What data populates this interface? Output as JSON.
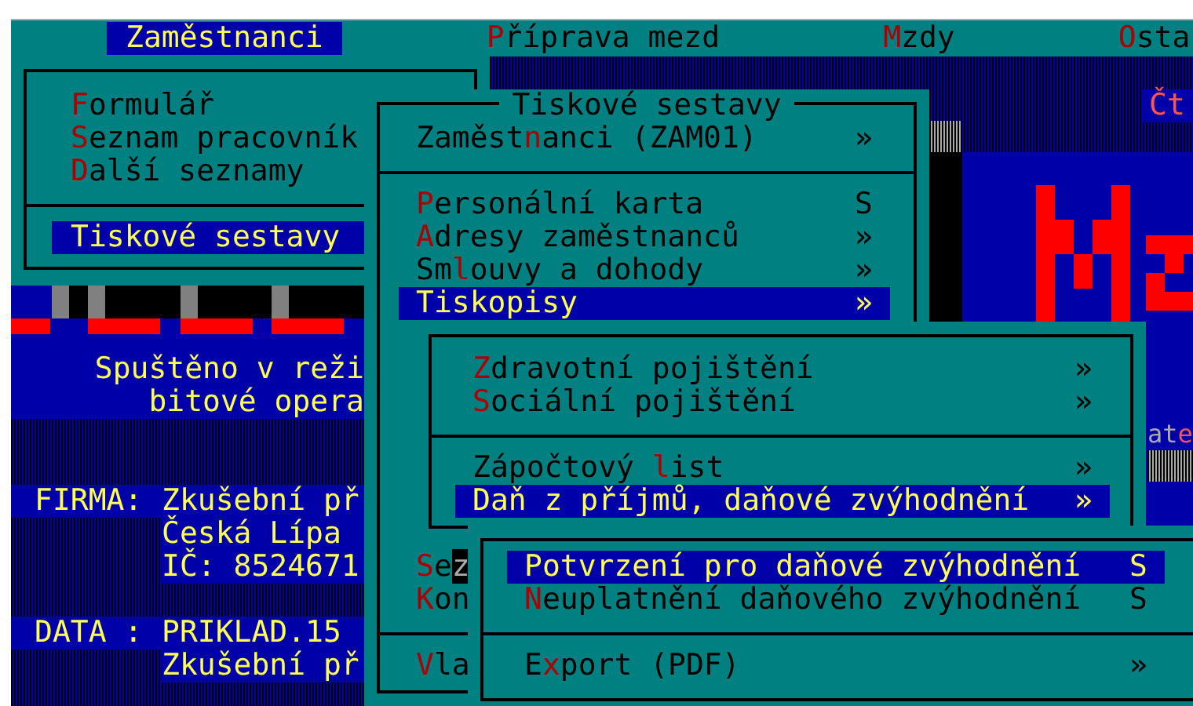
{
  "menu_bar": [
    {
      "key": "Z",
      "post": "aměstnanci",
      "selected": true
    },
    {
      "key": "P",
      "post": "říprava mezd",
      "selected": false
    },
    {
      "key": "M",
      "post": "zdy",
      "selected": false
    },
    {
      "key": "O",
      "post": "sta",
      "selected": false
    }
  ],
  "windows": [
    {
      "items": [
        {
          "kind": "item",
          "key": "F",
          "post": "ormulář",
          "selected": false
        },
        {
          "kind": "item",
          "key": "S",
          "post": "eznam pracovník",
          "selected": false
        },
        {
          "kind": "item",
          "key": "D",
          "post": "alší seznamy",
          "selected": false
        },
        {
          "kind": "separator"
        },
        {
          "kind": "item",
          "key": "T",
          "post": "iskové sestavy",
          "selected": true
        }
      ]
    },
    {
      "title": "Tiskové sestavy",
      "items": [
        {
          "kind": "item",
          "pre": "Zaměst",
          "key": "n",
          "post": "anci (ZAM01)",
          "shortcut": "»",
          "selected": false
        },
        {
          "kind": "separator"
        },
        {
          "kind": "item",
          "key": "P",
          "post": "ersonální karta",
          "shortcut": "S",
          "selected": false
        },
        {
          "kind": "item",
          "key": "A",
          "post": "dresy zaměstnanců",
          "shortcut": "»",
          "selected": false
        },
        {
          "kind": "item",
          "pre": "Sm",
          "key": "l",
          "post": "ouvy a dohody",
          "shortcut": "»",
          "selected": false
        },
        {
          "kind": "item",
          "key": "T",
          "post": "iskopisy",
          "shortcut": "»",
          "selected": true
        }
      ],
      "lower_items": [
        {
          "kind": "item",
          "key": "S",
          "post": "e",
          "cursor": "z",
          "selected": false
        },
        {
          "kind": "item",
          "key": "K",
          "post": "on",
          "selected": false
        },
        {
          "kind": "separator"
        },
        {
          "kind": "item",
          "key": "V",
          "post": "la",
          "selected": false
        }
      ]
    },
    {
      "items": [
        {
          "kind": "item",
          "key": "Z",
          "post": "dravotní pojištění",
          "shortcut": "»",
          "selected": false
        },
        {
          "kind": "item",
          "key": "S",
          "post": "ociální pojištění",
          "shortcut": "»",
          "selected": false
        },
        {
          "kind": "separator"
        },
        {
          "kind": "item",
          "pre": "Zápočtový ",
          "key": "l",
          "post": "ist",
          "shortcut": "»",
          "selected": false
        },
        {
          "kind": "item",
          "key": "D",
          "post": "aň z příjmů, daňové zvýhodnění",
          "shortcut": "»",
          "selected": true
        }
      ]
    },
    {
      "items": [
        {
          "kind": "item",
          "key": "P",
          "post": "otvrzení pro daňové zvýhodnění",
          "shortcut": "S",
          "selected": true
        },
        {
          "kind": "item",
          "key": "N",
          "post": "euplatnění daňového zvýhodnění",
          "shortcut": "S",
          "selected": false
        },
        {
          "kind": "separator"
        },
        {
          "kind": "item",
          "pre": "E",
          "key": "x",
          "post": "port (PDF)",
          "shortcut": "»",
          "selected": false
        }
      ]
    }
  ],
  "status_panel": {
    "lines": [
      "Spuštěno v reži",
      "bitové opera"
    ],
    "info": [
      {
        "label": "FIRMA:",
        "lines": [
          "Zkušební př",
          "Česká Lípa",
          "IČ: 8524671"
        ]
      },
      {
        "label": "DATA :",
        "lines": [
          "PRIKLAD.15",
          "Zkušební př"
        ]
      }
    ]
  },
  "right_panel": {
    "heading": "Čt",
    "caption": {
      "text": "at",
      "accent": "e"
    }
  }
}
